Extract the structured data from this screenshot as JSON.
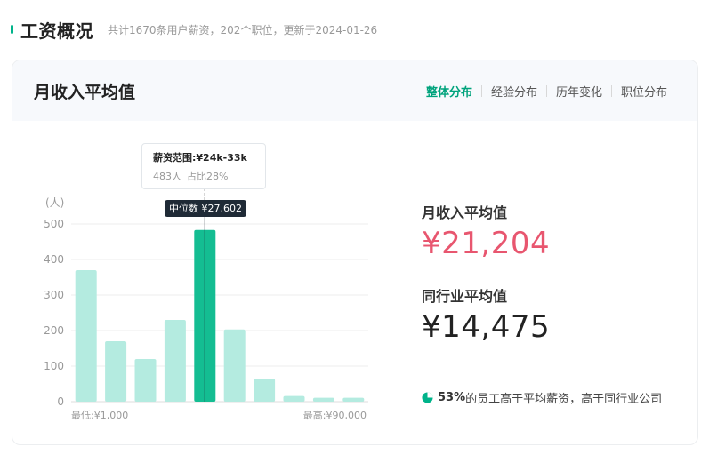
{
  "header": {
    "title": "工资概况",
    "subtitle": "共计1670条用户薪资，202个职位，更新于2024-01-26"
  },
  "card": {
    "title": "月收入平均值",
    "tabs": [
      {
        "label": "整体分布",
        "active": true
      },
      {
        "label": "经验分布",
        "active": false
      },
      {
        "label": "历年变化",
        "active": false
      },
      {
        "label": "职位分布",
        "active": false
      }
    ]
  },
  "tooltip": {
    "range": "薪资范围:¥24k-33k",
    "count": "483人",
    "share": "占比28%"
  },
  "median_badge": "中位数 ¥27,602",
  "stats": {
    "avg_label": "月收入平均值",
    "avg_value": "¥21,204",
    "industry_label": "同行业平均值",
    "industry_value": "¥14,475"
  },
  "footnote": {
    "percent": "53%",
    "text": "的员工高于平均薪资，高于同行业公司"
  },
  "colors": {
    "accent": "#00b38a",
    "bar_light": "#b4ebe0",
    "bar_highlight": "#14bd92",
    "avg_red": "#e8566f"
  },
  "chart_data": {
    "type": "bar",
    "ylabel": "(人)",
    "y_ticks": [
      0,
      100,
      200,
      300,
      400,
      500
    ],
    "ylim": [
      0,
      500
    ],
    "values": [
      370,
      170,
      120,
      230,
      483,
      203,
      65,
      16,
      11,
      11
    ],
    "highlight_index": 4,
    "median_index": 4,
    "x_start_label": "最低:¥1,000",
    "x_end_label": "最高:¥90,000",
    "grid": true
  }
}
